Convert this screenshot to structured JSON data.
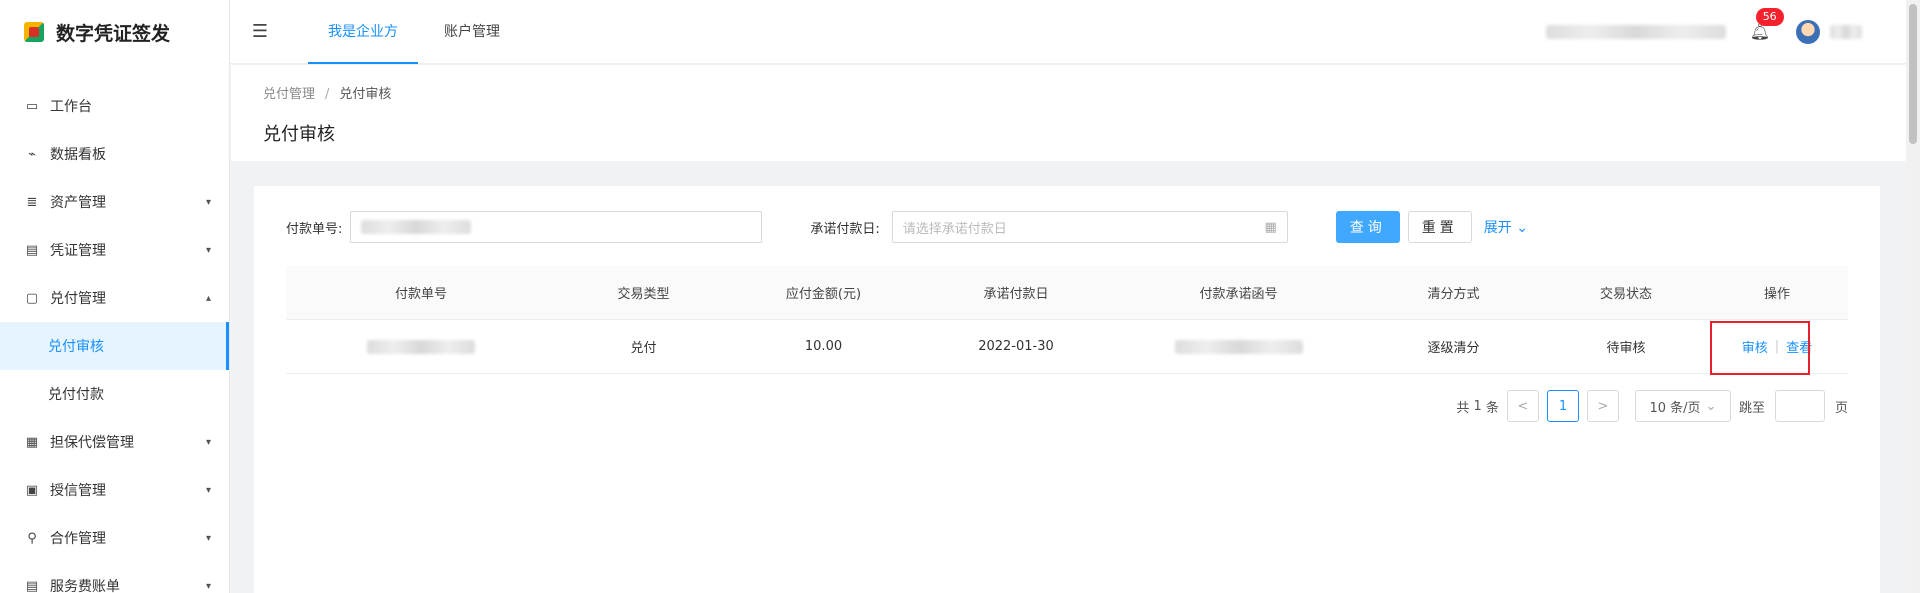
{
  "app": {
    "title": "数字凭证签发"
  },
  "sidebar": {
    "items": [
      {
        "icon": "monitor-icon",
        "label": "工作台"
      },
      {
        "icon": "chart-line-icon",
        "label": "数据看板"
      },
      {
        "icon": "database-icon",
        "label": "资产管理"
      },
      {
        "icon": "document-icon",
        "label": "凭证管理"
      },
      {
        "icon": "clipboard-icon",
        "label": "兑付管理"
      },
      {
        "icon": "printer-icon",
        "label": "担保代偿管理"
      },
      {
        "icon": "credit-box-icon",
        "label": "授信管理"
      },
      {
        "icon": "partner-icon",
        "label": "合作管理"
      },
      {
        "icon": "bill-icon",
        "label": "服务费账单"
      }
    ],
    "sub_items": [
      {
        "label": "兑付审核",
        "active": true
      },
      {
        "label": "兑付付款",
        "active": false
      }
    ]
  },
  "header": {
    "tabs": [
      {
        "label": "我是企业方",
        "active": true
      },
      {
        "label": "账户管理",
        "active": false
      }
    ],
    "notification_count": "56"
  },
  "page": {
    "breadcrumb": [
      "兑付管理",
      "兑付审核"
    ],
    "breadcrumb_sep": "/",
    "title": "兑付审核"
  },
  "filters": {
    "payment_no_label": "付款单号:",
    "promise_date_label": "承诺付款日:",
    "promise_date_placeholder": "请选择承诺付款日",
    "query_label": "查询",
    "reset_label": "重置",
    "expand_label": "展开"
  },
  "table": {
    "columns": [
      "付款单号",
      "交易类型",
      "应付金额(元)",
      "承诺付款日",
      "付款承诺函号",
      "清分方式",
      "交易状态",
      "操作"
    ],
    "rows": [
      {
        "trade_type": "兑付",
        "amount": "10.00",
        "promise_date": "2022-01-30",
        "clearing": "逐级清分",
        "status": "待审核",
        "actions": [
          "审核",
          "查看"
        ]
      }
    ]
  },
  "pagination": {
    "total_prefix": "共",
    "total_count": "1",
    "total_suffix": "条",
    "prev": "<",
    "current": "1",
    "next": ">",
    "page_size": "10 条/页",
    "jump_label": "跳至",
    "page_unit": "页"
  },
  "colors": {
    "accent": "#1890ff",
    "highlight_box": "#e5212d",
    "badge": "#f5222d"
  }
}
